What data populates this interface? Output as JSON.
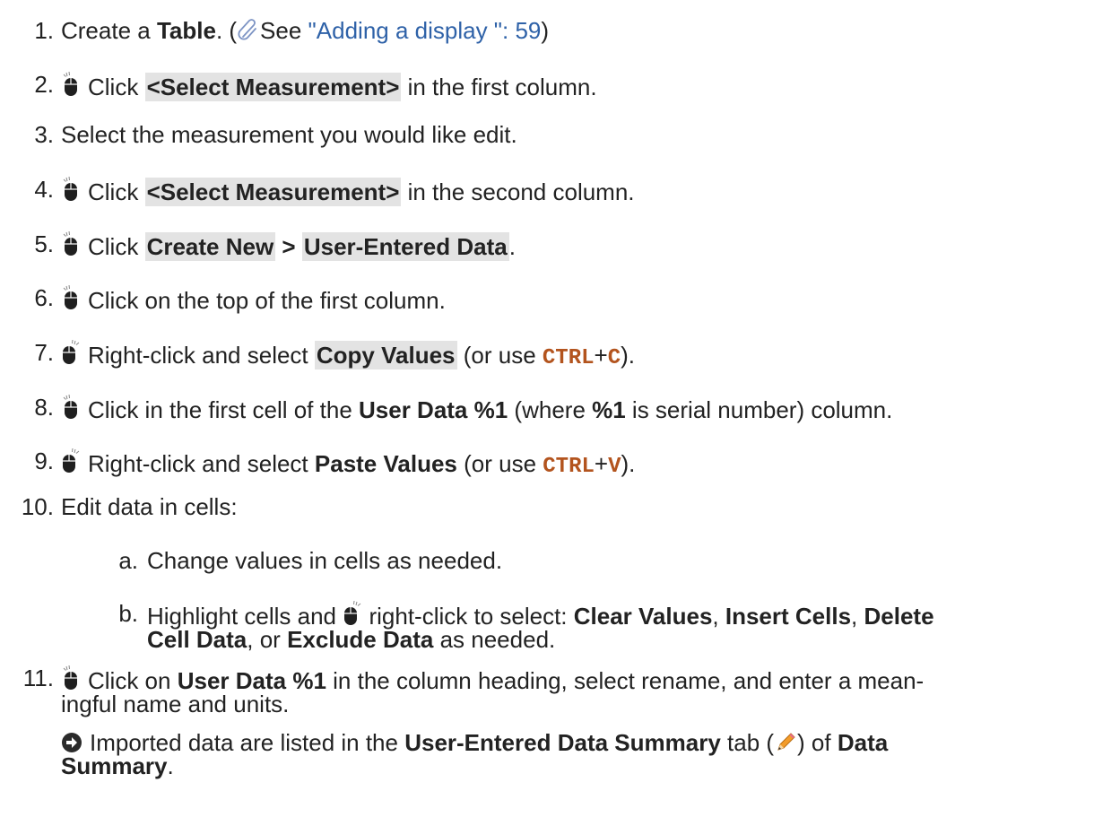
{
  "steps": [
    {
      "n": "1.",
      "a": "Create a ",
      "b1": "Table",
      "c": ". (",
      "link_pre": "See ",
      "link": "\"Adding a display \":  59",
      "d": ")"
    },
    {
      "n": "2.",
      "a": "Click ",
      "ui": "<Select Measurement>",
      "c": " in the first column."
    },
    {
      "n": "3.",
      "a": "Select the measurement you would like edit."
    },
    {
      "n": "4.",
      "a": "Click ",
      "ui": "<Select Measurement>",
      "c": " in the second column."
    },
    {
      "n": "5.",
      "a": "Click ",
      "ui1": "Create New",
      "sep": " > ",
      "ui2": "User-Entered Data",
      "c": "."
    },
    {
      "n": "6.",
      "a": "Click on the top of the first column."
    },
    {
      "n": "7.",
      "a": "Right-click and select ",
      "ui": "Copy Values",
      "c": " (or use ",
      "key1": "CTRL",
      "plus": "+",
      "key2": "C",
      "d": ")."
    },
    {
      "n": "8.",
      "a": "Click in the first cell of the ",
      "b1": "User Data %1",
      "c": " (where ",
      "b2": "%1",
      "d": " is serial number) column."
    },
    {
      "n": "9.",
      "a": "Right-click and select ",
      "b1": "Paste Values",
      "c": " (or use ",
      "key1": "CTRL",
      "plus": "+",
      "key2": "V",
      "d": ")."
    },
    {
      "n": "10.",
      "a": "Edit data in cells:"
    },
    {
      "n": "11.",
      "a": "Click on ",
      "b1": "User Data %1",
      "c": " in the column heading, select rename, and enter a mean-",
      "line2": "ingful name and units."
    }
  ],
  "substeps": [
    {
      "n": "a.",
      "a": "Change values in cells as needed."
    },
    {
      "n": "b.",
      "a": "Highlight cells and ",
      "a2": " right-click to select: ",
      "b1": "Clear Values",
      "s1": ", ",
      "b2": "Insert Cells",
      "s2": ", ",
      "b3": "Delete",
      "line2_b": "Cell Data",
      "s3": ", or ",
      "b4": "Exclude Data",
      "d": " as needed."
    }
  ],
  "note": {
    "a": "Imported data are listed in the ",
    "b1": "User-Entered Data Summary",
    "c": " tab (",
    "d": ") of ",
    "b2": "Data",
    "line2_b": "Summary",
    "e": "."
  }
}
